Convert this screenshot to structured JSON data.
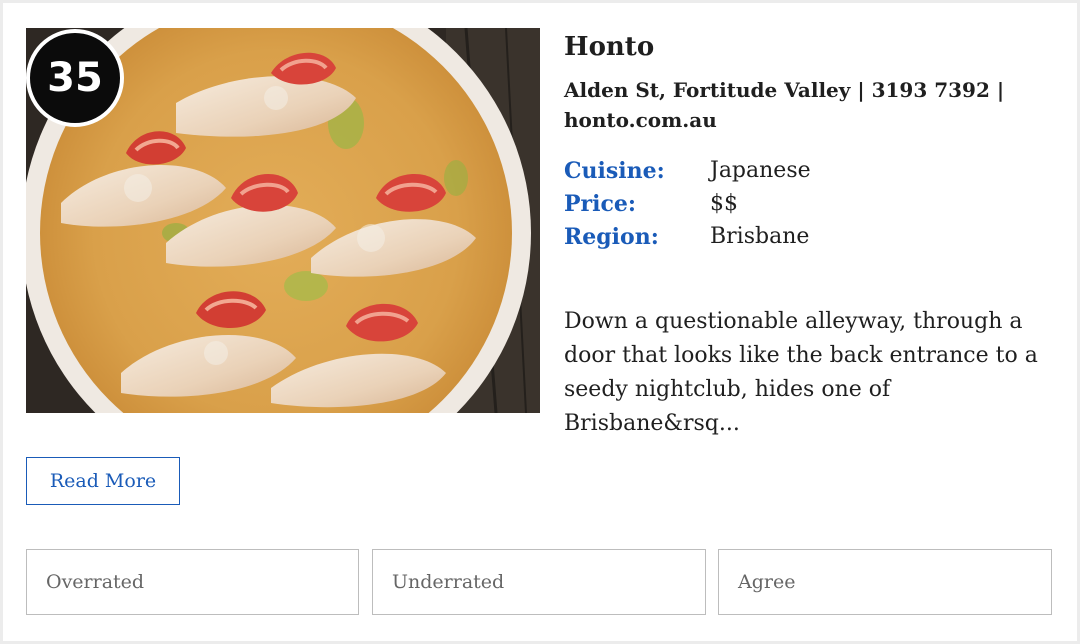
{
  "listing": {
    "rank": "35",
    "name": "Honto",
    "address": "Alden St, Fortitude Valley | 3193 7392 | honto.com.au",
    "details": [
      {
        "label": "Cuisine:",
        "value": "Japanese"
      },
      {
        "label": "Price:",
        "value": "$$"
      },
      {
        "label": "Region:",
        "value": "Brisbane"
      }
    ],
    "excerpt": "Down a questionable alleyway, through a door that looks like the back entrance to a seedy nightclub, hides one of Brisbane&rsq...",
    "read_more_label": "Read More"
  },
  "votes": {
    "overrated": "Overrated",
    "underrated": "Underrated",
    "agree": "Agree"
  },
  "colors": {
    "accent": "#1a5bb8",
    "text": "#1f1f1f",
    "badge": "#0b0b0b"
  }
}
